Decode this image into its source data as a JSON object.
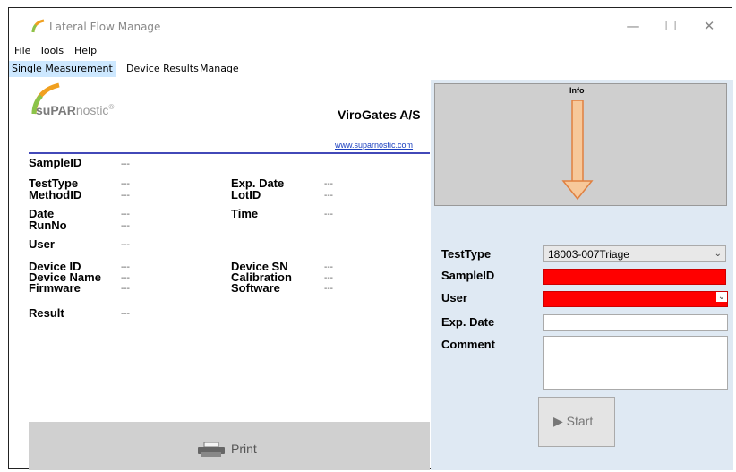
{
  "window": {
    "title": "Lateral Flow Manage",
    "minimize": "—",
    "maximize": "☐",
    "close": "✕"
  },
  "menu": [
    "File",
    "Tools",
    "Help"
  ],
  "tabs": [
    {
      "label": "Single Measurement",
      "active": true
    },
    {
      "label": "Device Results",
      "active": false
    },
    {
      "label": "Manage",
      "active": false
    }
  ],
  "header": {
    "logo_bold": "suPAR",
    "logo_light": "nostic",
    "logo_mark": "®",
    "company": "ViroGates A/S",
    "website": "www.suparnostic.com"
  },
  "details": {
    "sample_id": {
      "label": "SampleID",
      "value": "---"
    },
    "test_type": {
      "label": "TestType",
      "value": "---"
    },
    "method_id": {
      "label": "MethodID",
      "value": "---"
    },
    "exp_date": {
      "label": "Exp. Date",
      "value": "---"
    },
    "lot_id": {
      "label": "LotID",
      "value": "---"
    },
    "date": {
      "label": "Date",
      "value": "---"
    },
    "time": {
      "label": "Time",
      "value": "---"
    },
    "run_no": {
      "label": "RunNo",
      "value": "---"
    },
    "user": {
      "label": "User",
      "value": "---"
    },
    "device_id": {
      "label": "Device ID",
      "value": "---"
    },
    "device_sn": {
      "label": "Device SN",
      "value": "---"
    },
    "device_name": {
      "label": "Device Name",
      "value": "---"
    },
    "calibration": {
      "label": "Calibration",
      "value": "---"
    },
    "firmware": {
      "label": "Firmware",
      "value": "---"
    },
    "software": {
      "label": "Software",
      "value": "---"
    },
    "result": {
      "label": "Result",
      "value": "---"
    }
  },
  "print": {
    "label": "Print",
    "icon": "printer-icon"
  },
  "info": {
    "title": "Info",
    "icon": "arrow-down-icon"
  },
  "form": {
    "test_type": {
      "label": "TestType",
      "value": "18003-007Triage"
    },
    "sample_id": {
      "label": "SampleID",
      "value": ""
    },
    "user": {
      "label": "User",
      "value": ""
    },
    "exp_date": {
      "label": "Exp. Date",
      "value": ""
    },
    "comment": {
      "label": "Comment",
      "value": ""
    }
  },
  "start": {
    "label": "Start",
    "icon": "play-icon"
  },
  "colors": {
    "required_field": "#ff0000",
    "active_tab": "#cde8ff",
    "right_panel": "#dfe9f3",
    "divider": "#4248b8"
  }
}
